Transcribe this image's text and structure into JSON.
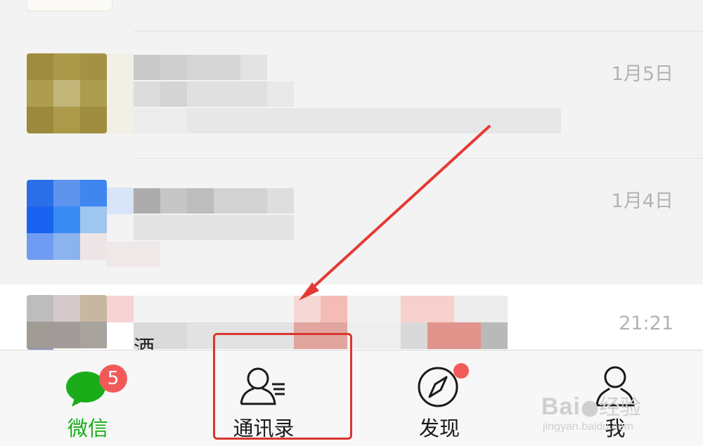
{
  "chats": [
    {
      "time": "1月5日"
    },
    {
      "time": "1月4日"
    },
    {
      "time": "21:21",
      "preview_char": "酒"
    }
  ],
  "tabs": [
    {
      "label": "微信",
      "icon": "chat-icon",
      "badge": "5",
      "active": true
    },
    {
      "label": "通讯录",
      "icon": "contacts-icon",
      "active": false
    },
    {
      "label": "发现",
      "icon": "compass-icon",
      "dot": true,
      "active": false
    },
    {
      "label": "我",
      "icon": "person-icon",
      "active": false
    }
  ],
  "watermark": {
    "brand": "Bai",
    "suffix": "经验",
    "url": "jingyan.baidu.com"
  },
  "colors": {
    "accent": "#1aad19",
    "badge": "#f25a5a",
    "annotation": "#d9362f"
  }
}
